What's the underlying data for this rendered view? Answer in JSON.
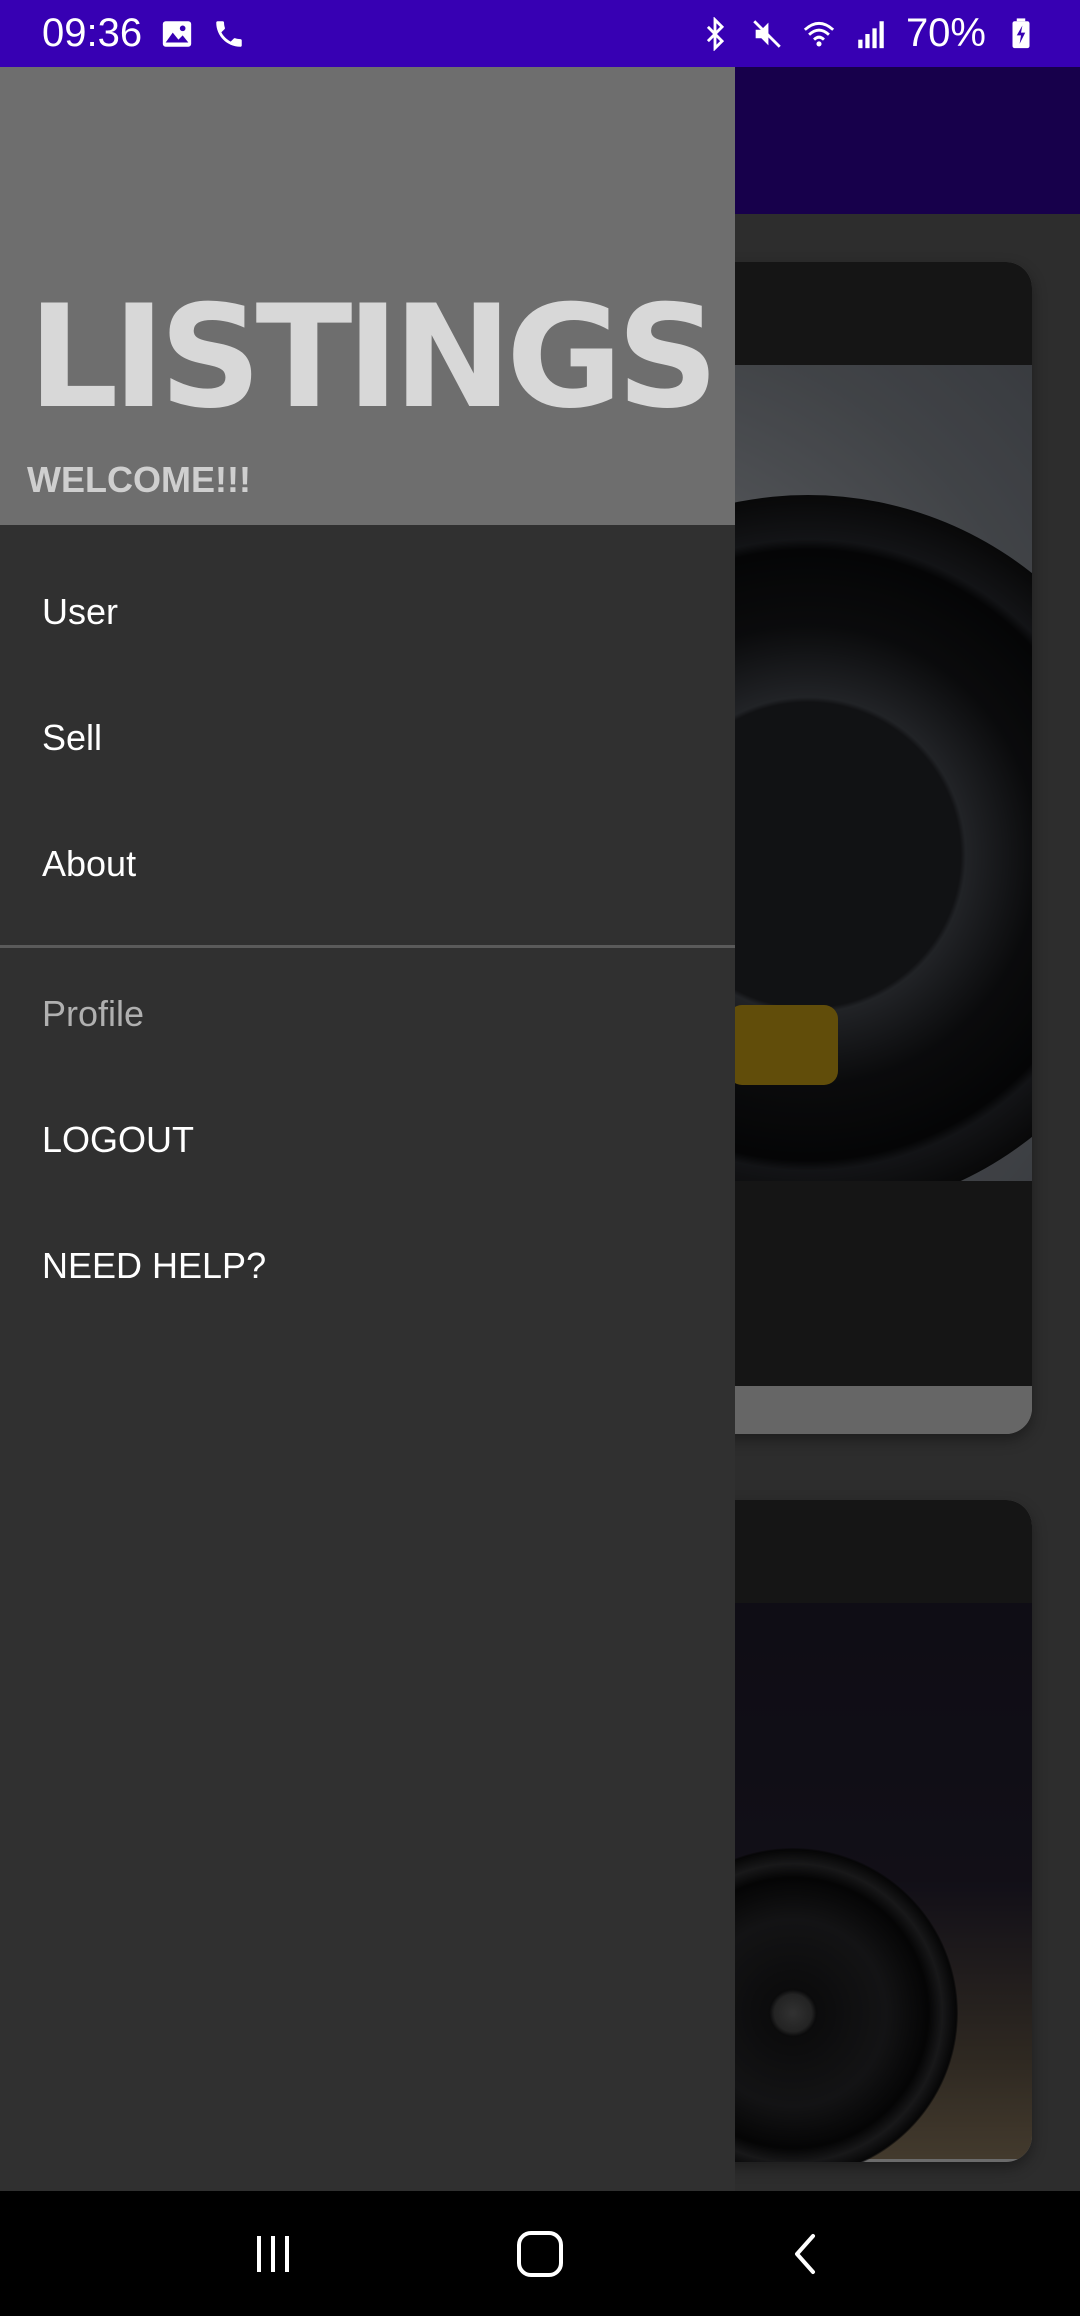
{
  "status_bar": {
    "time": "09:36",
    "battery": "70%",
    "icons_left": [
      "gallery-icon",
      "phone-icon"
    ],
    "icons_right": [
      "bluetooth-icon",
      "mute-icon",
      "wifi-icon",
      "signal-icon",
      "battery-icon"
    ]
  },
  "drawer": {
    "title": "LISTINGS",
    "subtitle": "WELCOME!!!",
    "items": [
      {
        "label": "User"
      },
      {
        "label": "Sell"
      },
      {
        "label": "About"
      },
      {
        "label": "Profile"
      },
      {
        "label": "LOGOUT"
      },
      {
        "label": "NEED HELP?"
      }
    ]
  },
  "colors": {
    "app_bar": "#3700b3",
    "drawer_bg": "#303030",
    "drawer_header": "#6e6e6e"
  },
  "nav_bar": {
    "buttons": [
      "recents-icon",
      "home-icon",
      "back-icon"
    ]
  }
}
